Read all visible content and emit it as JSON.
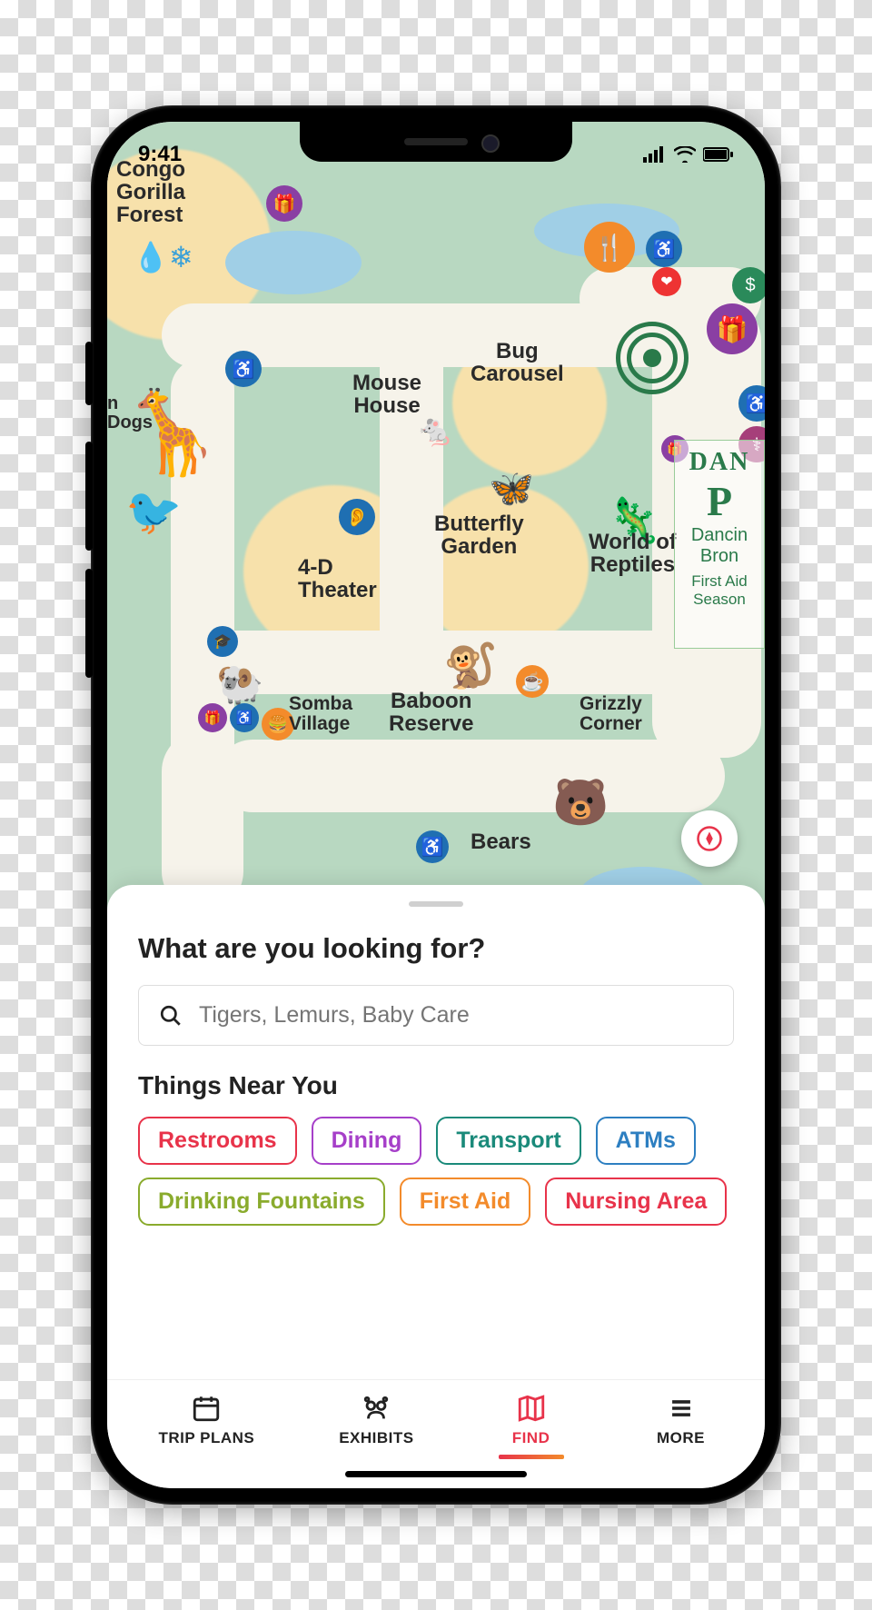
{
  "status": {
    "time": "9:41"
  },
  "map": {
    "labels": {
      "congo": "Congo\nGorilla\nForest",
      "mouse_house": "Mouse\nHouse",
      "bug_carousel": "Bug\nCarousel",
      "four_d": "4-D\nTheater",
      "butterfly": "Butterfly\nGarden",
      "reptiles": "World of\nReptiles",
      "baboon": "Baboon\nReserve",
      "somba": "Somba\nVillage",
      "grizzly": "Grizzly\nCorner",
      "bears": "Bears",
      "dancing_title": "Dancin\nBron",
      "dancing_sub": "First Aid\nSeason",
      "dogs": "n\nDogs"
    }
  },
  "sheet": {
    "title": "What are you looking for?",
    "search_placeholder": "Tigers, Lemurs, Baby Care",
    "near_title": "Things Near You",
    "chips": [
      {
        "label": "Restrooms",
        "color": "#e8334a"
      },
      {
        "label": "Dining",
        "color": "#a63fc9"
      },
      {
        "label": "Transport",
        "color": "#1a8a7a"
      },
      {
        "label": "ATMs",
        "color": "#2d7fc1"
      },
      {
        "label": "Drinking Fountains",
        "color": "#8aab2d"
      },
      {
        "label": "First Aid",
        "color": "#f38b2b"
      },
      {
        "label": "Nursing Area",
        "color": "#e8334a"
      }
    ]
  },
  "tabs": [
    {
      "id": "trip",
      "label": "TRIP PLANS",
      "active": false
    },
    {
      "id": "exhibits",
      "label": "EXHIBITS",
      "active": false
    },
    {
      "id": "find",
      "label": "FIND",
      "active": true
    },
    {
      "id": "more",
      "label": "MORE",
      "active": false
    }
  ]
}
